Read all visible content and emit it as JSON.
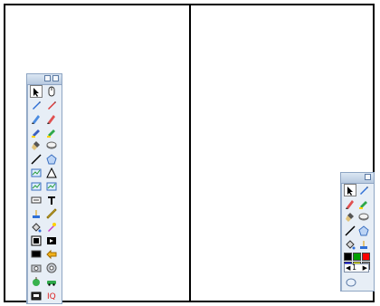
{
  "tools_left": [
    [
      "select-arrow-icon",
      "mouse-icon"
    ],
    [
      "pen-blue-icon",
      "pen-red-icon"
    ],
    [
      "pencil-blue-icon",
      "pencil-red-icon"
    ],
    [
      "highlighter-blue-icon",
      "highlighter-green-icon"
    ],
    [
      "brush-icon",
      "eraser-icon"
    ],
    [
      "line-icon",
      "shape-pentagon-icon"
    ],
    [
      "chart-icon",
      "triangle-icon"
    ],
    [
      "pie-chart-icon",
      "bar-chart-icon"
    ],
    [
      "keyboard-icon",
      "text-tool-icon"
    ],
    [
      "stamp-icon",
      "ruler-icon"
    ],
    [
      "fill-bucket-icon",
      "magic-pen-icon"
    ],
    [
      "screen-capture-icon",
      "camera-icon"
    ],
    [
      "black-screen-icon",
      "undo-arrow-icon"
    ],
    [
      "camera-photo-icon",
      "spotlight-icon"
    ],
    [
      "green-apple-icon",
      "green-car-icon"
    ],
    [
      "tools-box-icon",
      "iq-logo-icon"
    ]
  ],
  "tools_right": [
    [
      "select-arrow-icon",
      "pen-blue-icon"
    ],
    [
      "pencil-red-icon",
      "highlighter-green-icon"
    ],
    [
      "brush-icon",
      "eraser-icon"
    ],
    [
      "line-icon",
      "shape-pentagon-icon"
    ],
    [
      "fill-bucket-icon",
      "stamp-icon"
    ]
  ],
  "palette": [
    "#000000",
    "#00a000",
    "#ff0000",
    "#0000ff",
    "#ffff00",
    "#808080"
  ],
  "width_stepper": {
    "value": "1",
    "left_glyph": "◀",
    "right_glyph": "▶"
  },
  "iq_text": "IQ"
}
